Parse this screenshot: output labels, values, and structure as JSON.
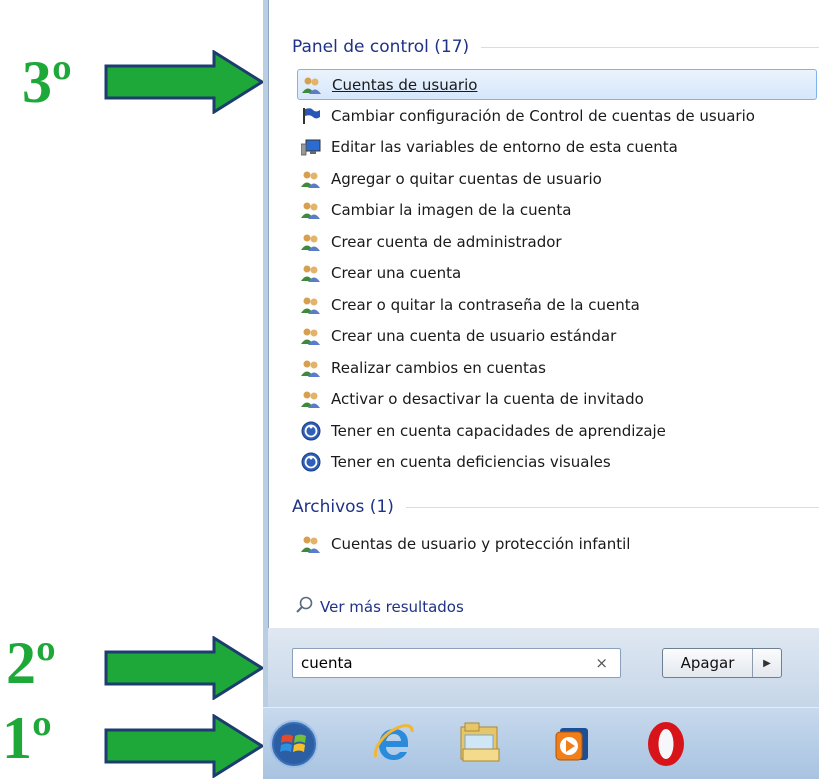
{
  "annotations": {
    "step1": "1º",
    "step2": "2º",
    "step3": "3º"
  },
  "control_panel": {
    "header": "Panel de control (17)",
    "items": [
      {
        "label": "Cuentas de usuario",
        "icon": "users-icon"
      },
      {
        "label": "Cambiar configuración de Control de cuentas de usuario",
        "icon": "flag-icon"
      },
      {
        "label": "Editar las variables de entorno de esta cuenta",
        "icon": "system-monitor-icon"
      },
      {
        "label": "Agregar o quitar cuentas de usuario",
        "icon": "users-icon"
      },
      {
        "label": "Cambiar la imagen de la cuenta",
        "icon": "users-icon"
      },
      {
        "label": "Crear cuenta de administrador",
        "icon": "users-icon"
      },
      {
        "label": "Crear una cuenta",
        "icon": "users-icon"
      },
      {
        "label": "Crear o quitar la contraseña de la cuenta",
        "icon": "users-icon"
      },
      {
        "label": "Crear una cuenta de usuario estándar",
        "icon": "users-icon"
      },
      {
        "label": "Realizar cambios en cuentas",
        "icon": "users-icon"
      },
      {
        "label": "Activar o desactivar la cuenta de invitado",
        "icon": "users-icon"
      },
      {
        "label": "Tener en cuenta capacidades de aprendizaje",
        "icon": "ease-of-access-icon"
      },
      {
        "label": "Tener en cuenta deficiencias visuales",
        "icon": "ease-of-access-icon"
      }
    ]
  },
  "files": {
    "header": "Archivos (1)",
    "items": [
      {
        "label": "Cuentas de usuario y protección infantil",
        "icon": "users-icon"
      }
    ]
  },
  "more_results": "Ver más resultados",
  "search": {
    "value": "cuenta",
    "clear_symbol": "×"
  },
  "shutdown": {
    "label": "Apagar",
    "arrow": "▶"
  },
  "taskbar": {
    "items": [
      "start-orb-icon",
      "internet-explorer-icon",
      "file-explorer-icon",
      "media-player-icon",
      "opera-icon"
    ]
  },
  "colors": {
    "annotation_green": "#1fa83a",
    "annotation_arrow_outline": "#1c3d6e",
    "header_text": "#1e3287"
  }
}
